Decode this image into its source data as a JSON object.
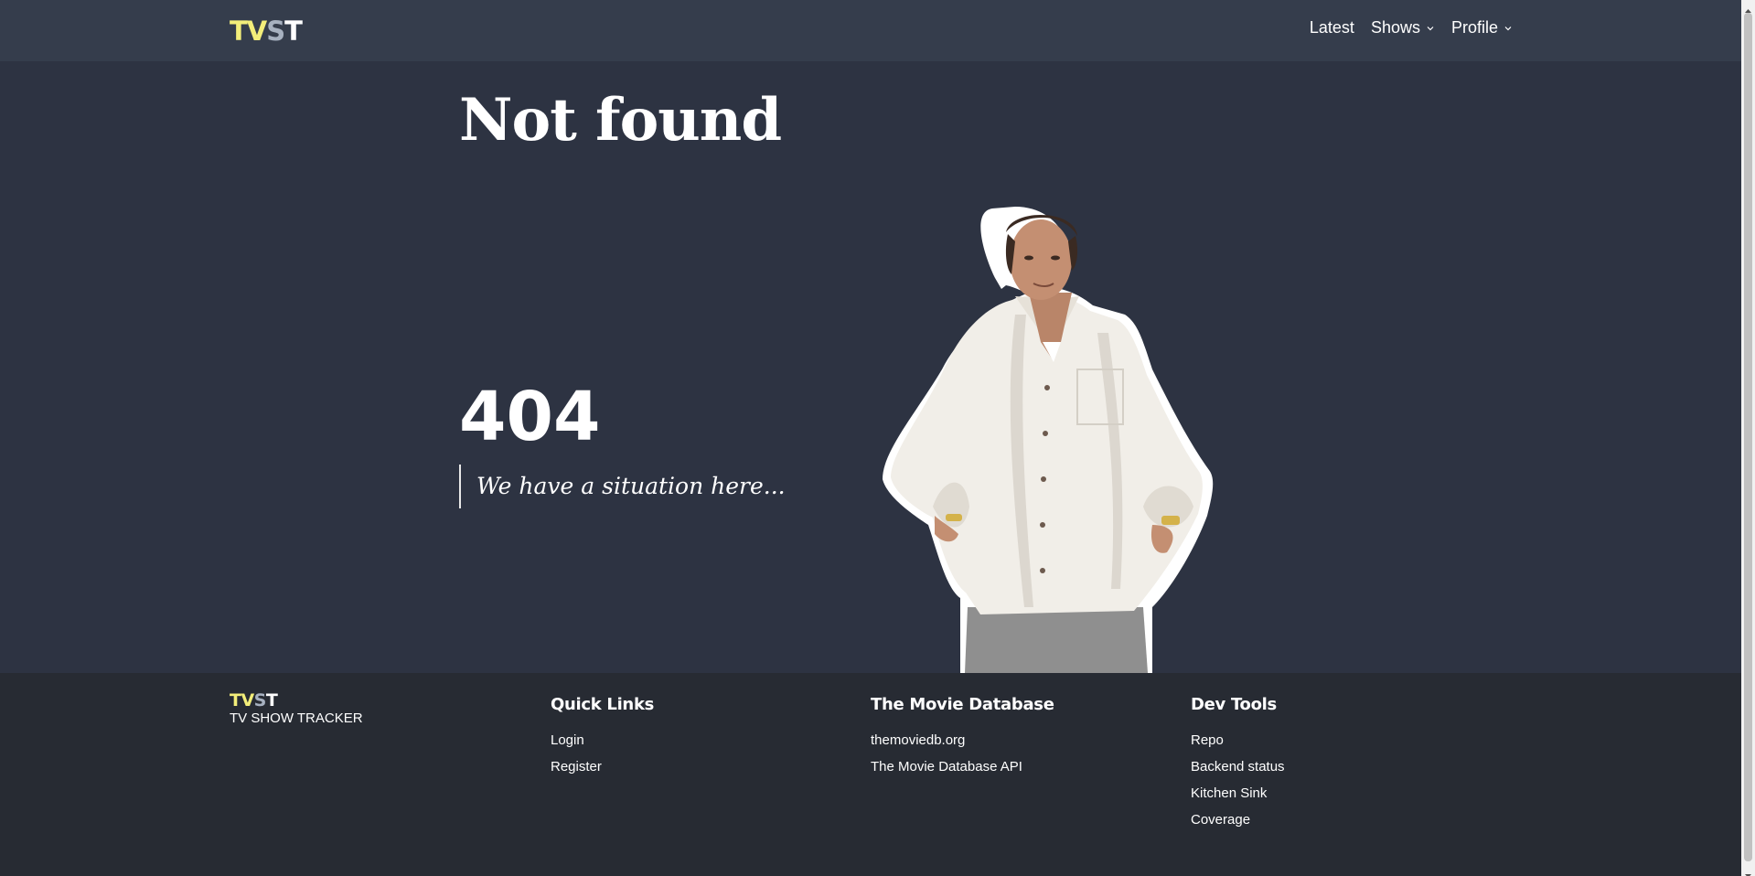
{
  "header": {
    "logo": {
      "part1": "TV",
      "part2": "S",
      "part3": "T"
    },
    "nav": [
      {
        "label": "Latest",
        "has_dropdown": false
      },
      {
        "label": "Shows",
        "has_dropdown": true
      },
      {
        "label": "Profile",
        "has_dropdown": true
      }
    ]
  },
  "main": {
    "title": "Not found",
    "code": "404",
    "message": "We have a situation here..."
  },
  "footer": {
    "logo": {
      "part1": "TV",
      "part2": "S",
      "part3": "T"
    },
    "tagline": "TV SHOW TRACKER",
    "columns": [
      {
        "title": "Quick Links",
        "links": [
          "Login",
          "Register"
        ]
      },
      {
        "title": "The Movie Database",
        "links": [
          "themoviedb.org",
          "The Movie Database API"
        ]
      },
      {
        "title": "Dev Tools",
        "links": [
          "Repo",
          "Backend status",
          "Kitchen Sink",
          "Coverage"
        ]
      }
    ]
  },
  "colors": {
    "background": "#2d3342",
    "header_bg": "#353d4c",
    "footer_bg": "#272b33",
    "logo_yellow": "#f3ee7a",
    "logo_gray": "#a7b1c0"
  }
}
